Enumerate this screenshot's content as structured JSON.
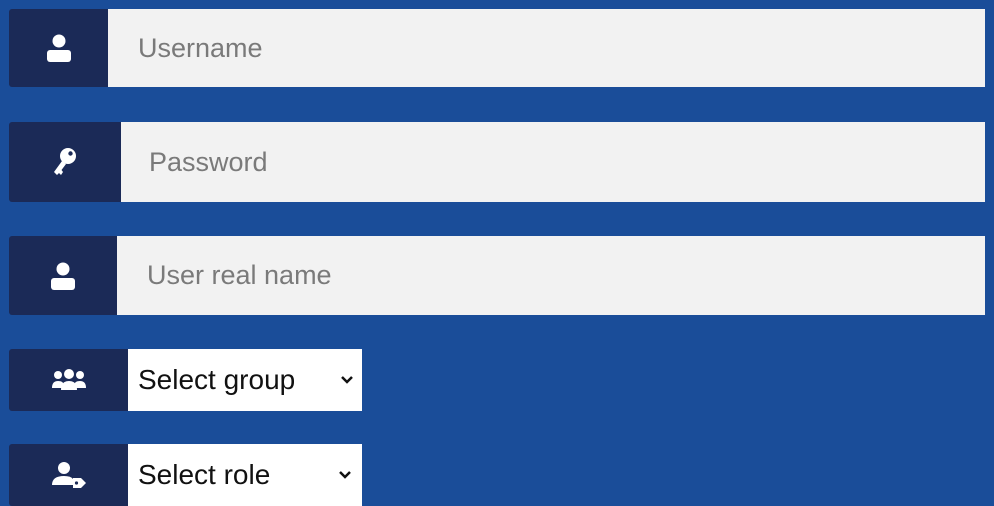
{
  "form": {
    "username": {
      "placeholder": "Username",
      "icon": "user-icon"
    },
    "password": {
      "placeholder": "Password",
      "icon": "key-icon"
    },
    "realname": {
      "placeholder": "User real name",
      "icon": "user-icon"
    },
    "group": {
      "selected": "Select group",
      "icon": "users-group-icon"
    },
    "role": {
      "selected": "Select role",
      "icon": "user-tag-icon"
    }
  },
  "colors": {
    "background": "#1a4d99",
    "icon_box": "#1b2a57",
    "input_bg": "#f2f2f2",
    "placeholder": "#7a7a7a"
  }
}
